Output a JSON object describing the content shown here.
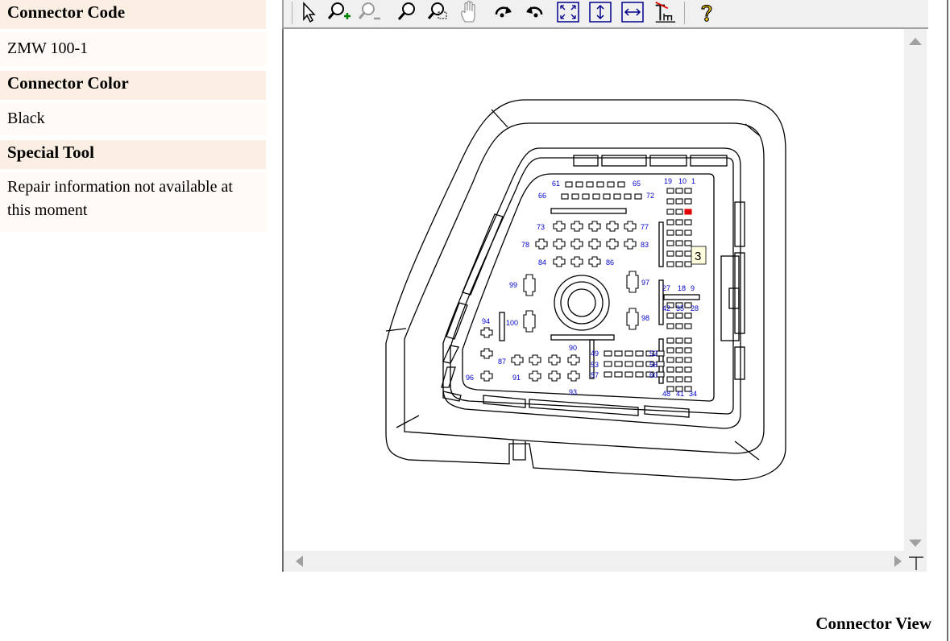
{
  "info": {
    "connector_code_label": "Connector Code",
    "connector_code_value": "ZMW 100-1",
    "connector_color_label": "Connector Color",
    "connector_color_value": "Black",
    "special_tool_label": "Special Tool",
    "special_tool_value": "Repair information not available at this moment"
  },
  "toolbar": {
    "icons": [
      "select-arrow-icon",
      "zoom-in-icon",
      "zoom-out-icon",
      "zoom-icon",
      "zoom-window-icon",
      "pan-hand-icon",
      "rotate-cw-icon",
      "rotate-ccw-icon",
      "fit-all-icon",
      "fit-height-icon",
      "fit-width-icon",
      "text-search-icon",
      "help-icon"
    ]
  },
  "diagram": {
    "labels": [
      "61",
      "65",
      "66",
      "72",
      "19",
      "10",
      "1",
      "73",
      "77",
      "78",
      "83",
      "84",
      "86",
      "99",
      "97",
      "27",
      "18",
      "9",
      "42",
      "35",
      "28",
      "94",
      "100",
      "98",
      "90",
      "49",
      "52",
      "53",
      "56",
      "57",
      "60",
      "96",
      "87",
      "91",
      "93",
      "48",
      "41",
      "34"
    ],
    "tooltip": "3",
    "highlight_color": "#e00000",
    "pin_label_color": "#0000cc"
  },
  "caption": "Connector View"
}
